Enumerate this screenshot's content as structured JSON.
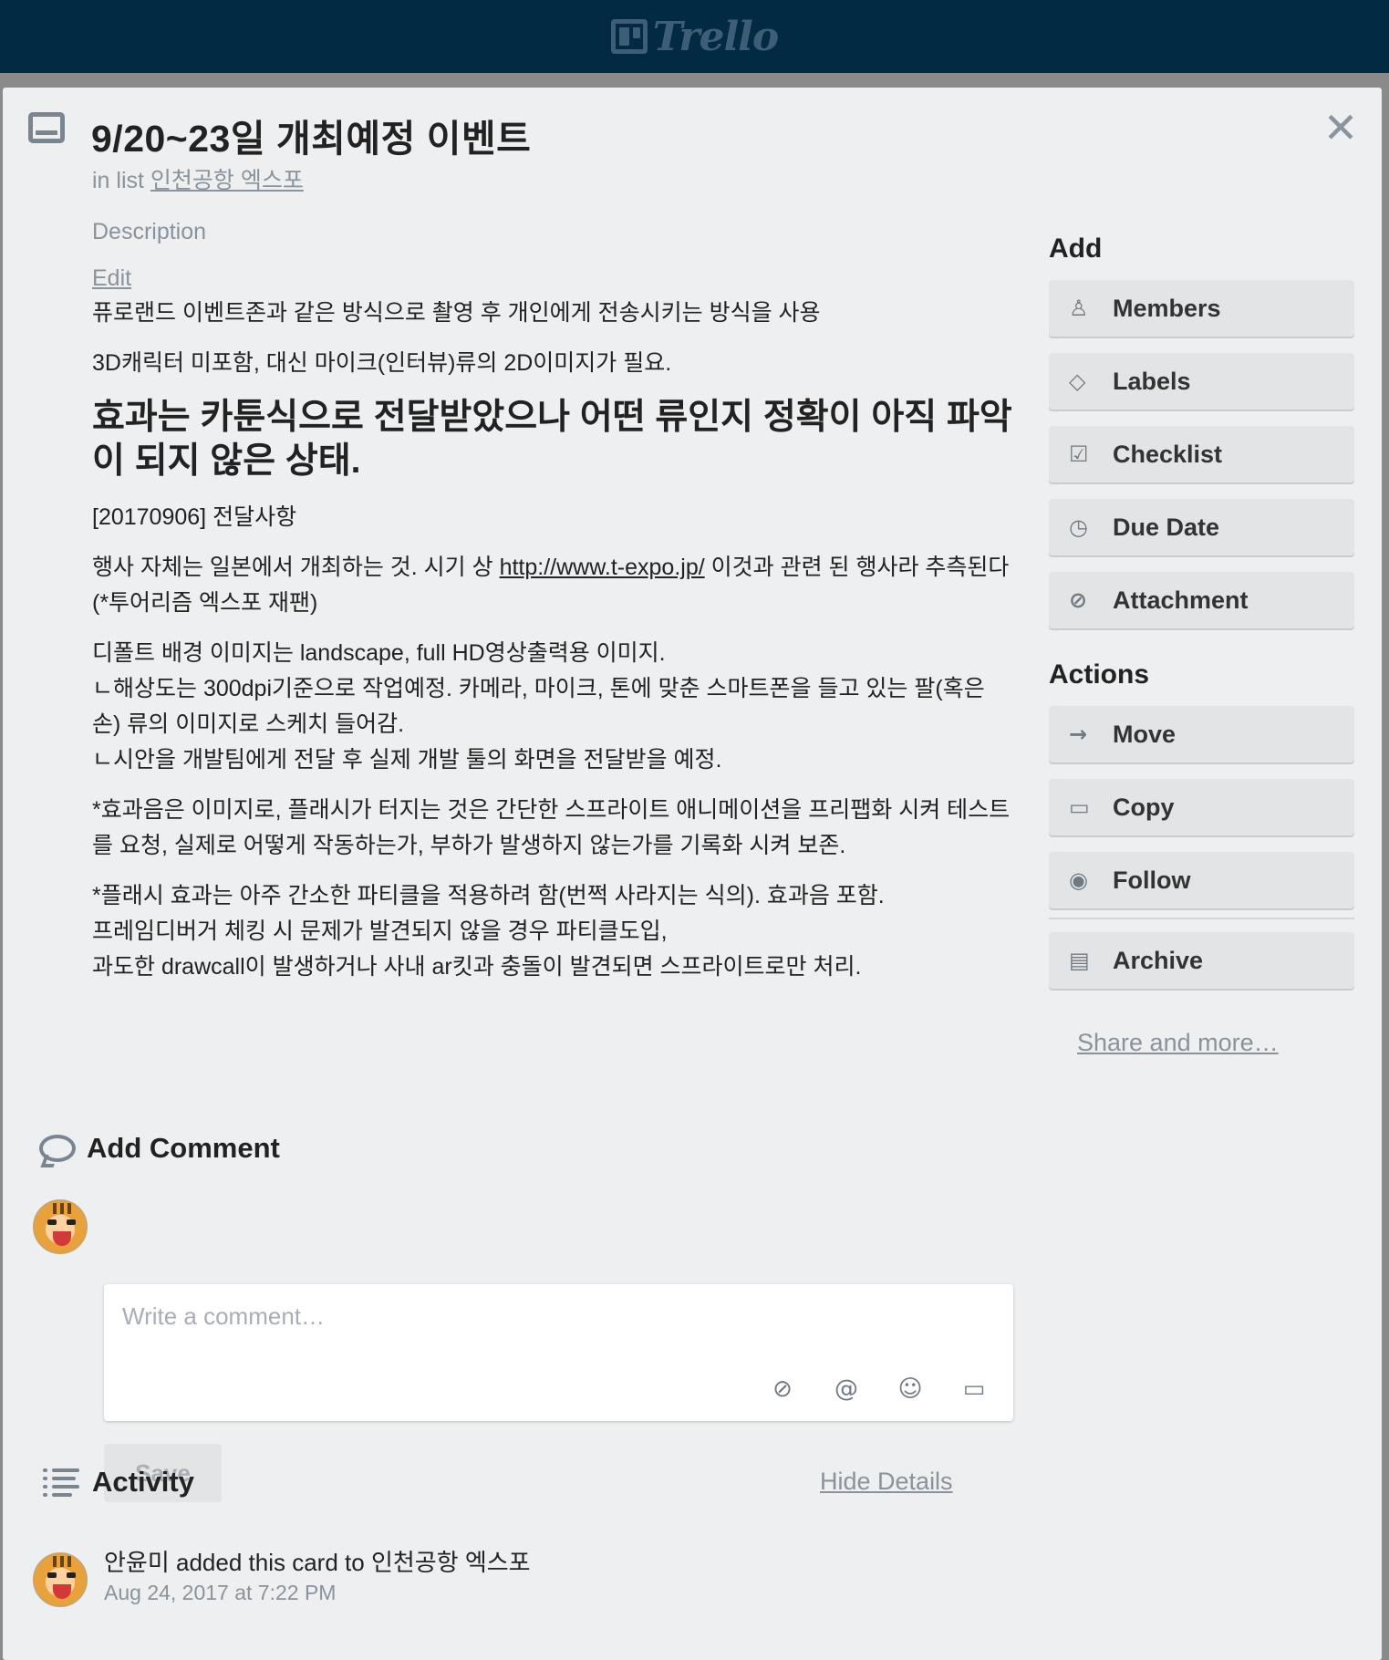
{
  "app": {
    "logo_text": "Trello"
  },
  "card": {
    "title": "9/20~23일 개최예정 이벤트",
    "in_list_prefix": "in list",
    "list_name": "인천공항 엑스포"
  },
  "description": {
    "label": "Description",
    "edit_label": "Edit",
    "p1": "퓨로랜드 이벤트존과 같은 방식으로 촬영 후 개인에게 전송시키는 방식을 사용",
    "p2": "3D캐릭터 미포함, 대신 마이크(인터뷰)류의 2D이미지가 필요.",
    "heading": "효과는 카툰식으로 전달받았으나 어떤 류인지 정확이 아직 파악이 되지 않은 상태.",
    "p3": "[20170906] 전달사항",
    "p4_before": "행사 자체는 일본에서 개최하는 것. 시기 상 ",
    "p4_link": "http://www.t-expo.jp/",
    "p4_after": " 이것과 관련 된 행사라 추측된다(*투어리즘 엑스포 재팬)",
    "p5_l1": "디폴트 배경 이미지는 landscape, full HD영상출력용 이미지.",
    "p5_l2": "ㄴ해상도는 300dpi기준으로 작업예정. 카메라, 마이크, 톤에 맞춘 스마트폰을 들고 있는 팔(혹은 손) 류의 이미지로 스케치 들어감.",
    "p5_l3": "ㄴ시안을 개발팀에게 전달 후 실제 개발 툴의 화면을 전달받을 예정.",
    "p6": "*효과음은 이미지로, 플래시가 터지는 것은 간단한 스프라이트 애니메이션을 프리팹화 시켜 테스트를 요청, 실제로 어떻게 작동하는가, 부하가 발생하지 않는가를 기록화 시켜 보존.",
    "p7_l1": "*플래시 효과는 아주 간소한 파티클을 적용하려 함(번쩍 사라지는 식의). 효과음 포함.",
    "p7_l2": "프레임디버거 체킹 시 문제가 발견되지 않을 경우 파티클도입,",
    "p7_l3": "과도한 drawcall이 발생하거나 사내 ar킷과 충돌이 발견되면 스프라이트로만 처리."
  },
  "sidebar": {
    "add_heading": "Add",
    "add_items": [
      {
        "label": "Members",
        "icon": "person-icon"
      },
      {
        "label": "Labels",
        "icon": "tag-icon"
      },
      {
        "label": "Checklist",
        "icon": "checkbox-icon"
      },
      {
        "label": "Due Date",
        "icon": "clock-icon"
      },
      {
        "label": "Attachment",
        "icon": "paperclip-icon"
      }
    ],
    "actions_heading": "Actions",
    "action_items": [
      {
        "label": "Move",
        "icon": "arrow-right-icon"
      },
      {
        "label": "Copy",
        "icon": "card-icon"
      },
      {
        "label": "Follow",
        "icon": "eye-icon"
      },
      {
        "label": "Archive",
        "icon": "archive-icon"
      }
    ],
    "share_label": "Share and more…"
  },
  "comment": {
    "heading": "Add Comment",
    "placeholder": "Write a comment…",
    "save_label": "Save"
  },
  "activity": {
    "heading": "Activity",
    "hide_details_label": "Hide Details",
    "entry_user": "안윤미",
    "entry_action": "added this card to",
    "entry_list": "인천공항 엑스포",
    "entry_time": "Aug 24, 2017 at 7:22 PM"
  }
}
